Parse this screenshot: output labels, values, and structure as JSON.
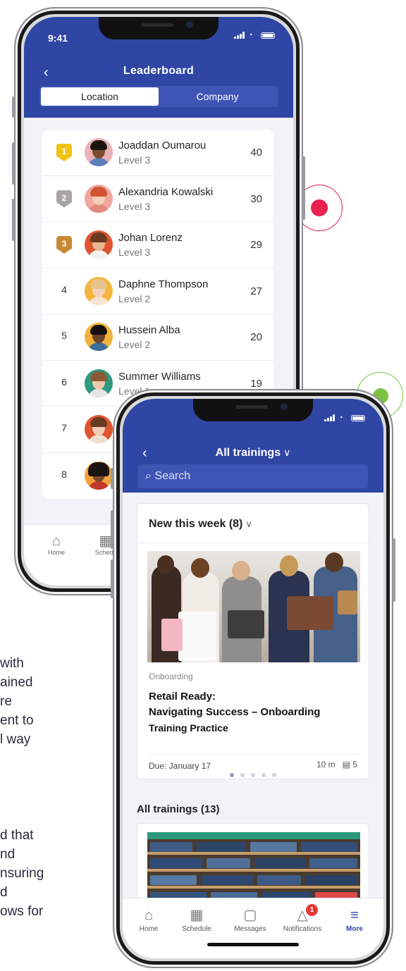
{
  "background_text": {
    "upper_lines": [
      "with",
      "ained",
      "re",
      "ent to",
      "l way"
    ],
    "lower_lines": [
      "d that",
      "nd",
      "nsuring",
      "d",
      "ows for"
    ]
  },
  "decor": {
    "red_accent": "#e8214f",
    "green_accent": "#7cc242",
    "brand_blue": "#2f46a5"
  },
  "leaderboard_phone": {
    "status_time": "9:41",
    "back_icon": "chevron-left-icon",
    "title": "Leaderboard",
    "segments": [
      {
        "label": "Location",
        "active": true
      },
      {
        "label": "Company",
        "active": false
      }
    ],
    "rows": [
      {
        "rank": "1",
        "badge_color": "#f2c316",
        "name": "Joaddan Oumarou",
        "level": "Level 3",
        "score": "40"
      },
      {
        "rank": "2",
        "badge_color": "#a8a4a6",
        "name": "Alexandria Kowalski",
        "level": "Level 3",
        "score": "30"
      },
      {
        "rank": "3",
        "badge_color": "#c98a35",
        "name": "Johan Lorenz",
        "level": "Level 3",
        "score": "29"
      },
      {
        "rank": "4",
        "badge_color": "",
        "name": "Daphne Thompson",
        "level": "Level 2",
        "score": "27"
      },
      {
        "rank": "5",
        "badge_color": "",
        "name": "Hussein Alba",
        "level": "Level 2",
        "score": "20"
      },
      {
        "rank": "6",
        "badge_color": "",
        "name": "Summer Williams",
        "level": "Level 1",
        "score": "19"
      },
      {
        "rank": "7",
        "badge_color": "",
        "name": "",
        "level": "",
        "score": ""
      },
      {
        "rank": "8",
        "badge_color": "",
        "name": "",
        "level": "",
        "score": ""
      }
    ],
    "tabs": [
      {
        "label": "Home",
        "icon": "home-icon"
      },
      {
        "label": "Schedu",
        "icon": "calendar-icon"
      }
    ]
  },
  "trainings_phone": {
    "title": "All trainings",
    "title_icon": "chevron-down-icon",
    "back_icon": "chevron-left-icon",
    "search_placeholder": "Search",
    "featured": {
      "heading": "New this week (8)",
      "category": "Onboarding",
      "title_lines": [
        "Retail Ready:",
        "Navigating Success – Onboarding",
        "Training Practice"
      ],
      "due": "Due: January 17",
      "duration": "10 m",
      "lessons": "5",
      "page_dots": 5,
      "active_dot": 0
    },
    "all_heading": "All trainings (13)",
    "tabs": [
      {
        "label": "Home",
        "icon": "home-icon",
        "active": false
      },
      {
        "label": "Schedule",
        "icon": "calendar-icon",
        "active": false
      },
      {
        "label": "Messages",
        "icon": "chat-icon",
        "active": false
      },
      {
        "label": "Notifications",
        "icon": "bell-icon",
        "active": false,
        "badge": "1"
      },
      {
        "label": "More",
        "icon": "menu-icon",
        "active": true
      }
    ]
  }
}
